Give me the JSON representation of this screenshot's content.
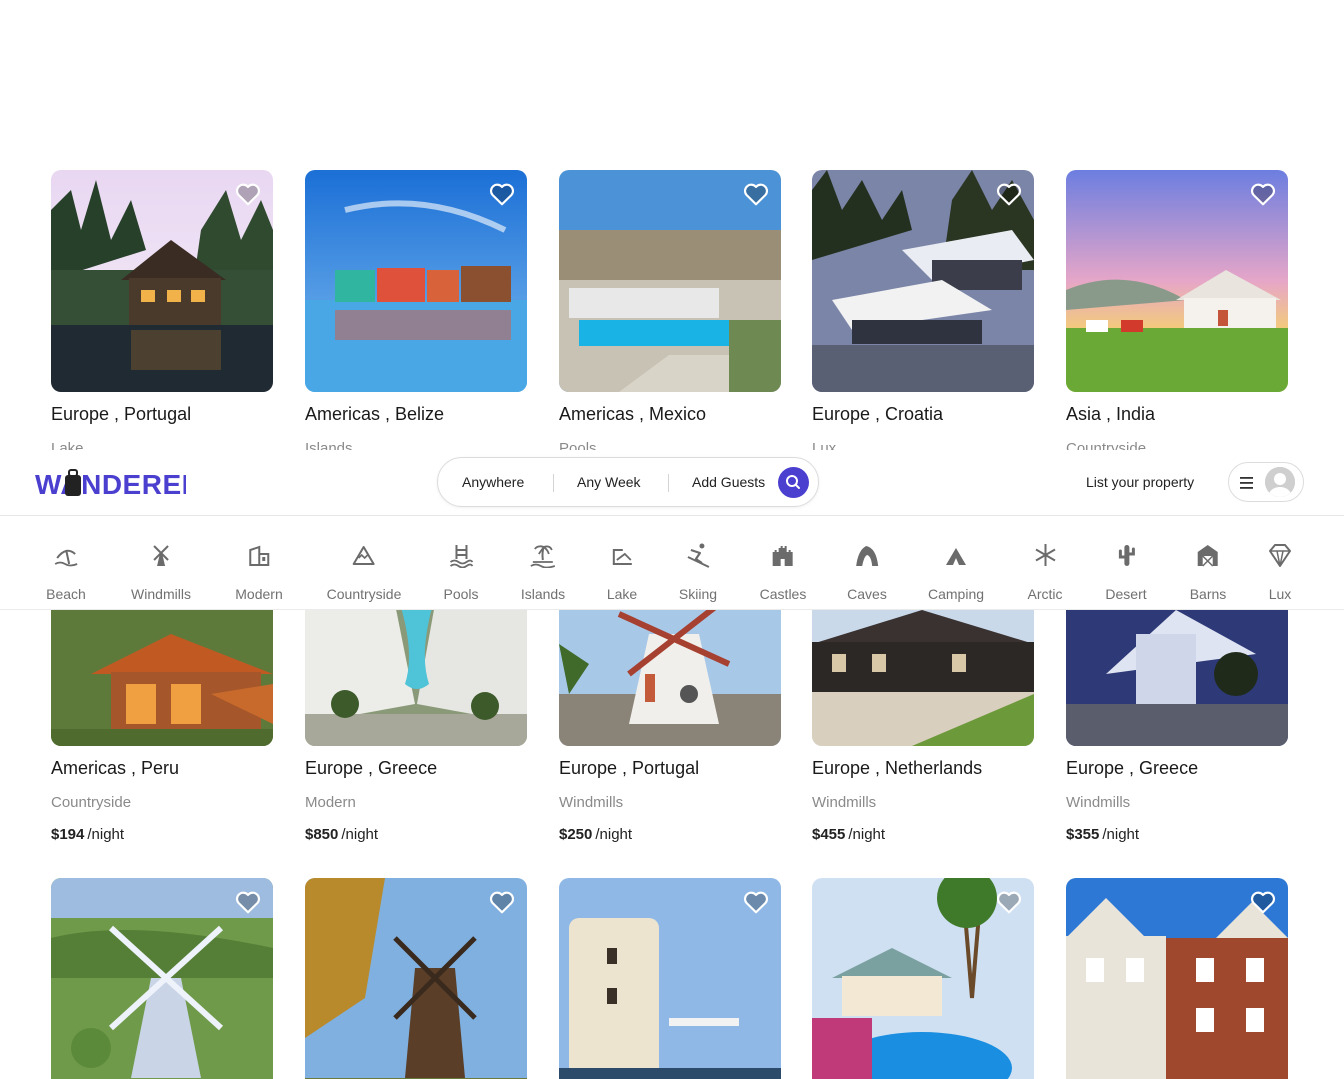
{
  "brand": {
    "name": "WANDERER"
  },
  "header": {
    "search": {
      "where": "Anywhere",
      "when": "Any Week",
      "who": "Add Guests"
    },
    "list_property": "List your property"
  },
  "categories": [
    {
      "label": "Beach",
      "icon": "beach-icon"
    },
    {
      "label": "Windmills",
      "icon": "windmill-icon"
    },
    {
      "label": "Modern",
      "icon": "modern-house-icon"
    },
    {
      "label": "Countryside",
      "icon": "mountain-icon"
    },
    {
      "label": "Pools",
      "icon": "pool-icon"
    },
    {
      "label": "Islands",
      "icon": "island-icon"
    },
    {
      "label": "Lake",
      "icon": "lake-icon"
    },
    {
      "label": "Skiing",
      "icon": "skiing-icon"
    },
    {
      "label": "Castles",
      "icon": "castle-icon"
    },
    {
      "label": "Caves",
      "icon": "cave-icon"
    },
    {
      "label": "Camping",
      "icon": "tent-icon"
    },
    {
      "label": "Arctic",
      "icon": "snowflake-icon"
    },
    {
      "label": "Desert",
      "icon": "cactus-icon"
    },
    {
      "label": "Barns",
      "icon": "barn-icon"
    },
    {
      "label": "Lux",
      "icon": "diamond-icon"
    }
  ],
  "listings_row1": [
    {
      "location": "Europe , Portugal",
      "category": "Lake"
    },
    {
      "location": "Americas , Belize",
      "category": "Islands"
    },
    {
      "location": "Americas , Mexico",
      "category": "Pools"
    },
    {
      "location": "Europe , Croatia",
      "category": "Lux"
    },
    {
      "location": "Asia , India",
      "category": "Countryside"
    }
  ],
  "listings_row2": [
    {
      "location": "Americas , Peru",
      "category": "Countryside",
      "price": "$194",
      "unit": "/night"
    },
    {
      "location": "Europe , Greece",
      "category": "Modern",
      "price": "$850",
      "unit": "/night"
    },
    {
      "location": "Europe , Portugal",
      "category": "Windmills",
      "price": "$250",
      "unit": "/night"
    },
    {
      "location": "Europe , Netherlands",
      "category": "Windmills",
      "price": "$455",
      "unit": "/night"
    },
    {
      "location": "Europe , Greece",
      "category": "Windmills",
      "price": "$355",
      "unit": "/night"
    }
  ],
  "colors": {
    "brand": "#4b3fd0",
    "text": "#222222",
    "muted": "#8a8a8a"
  }
}
